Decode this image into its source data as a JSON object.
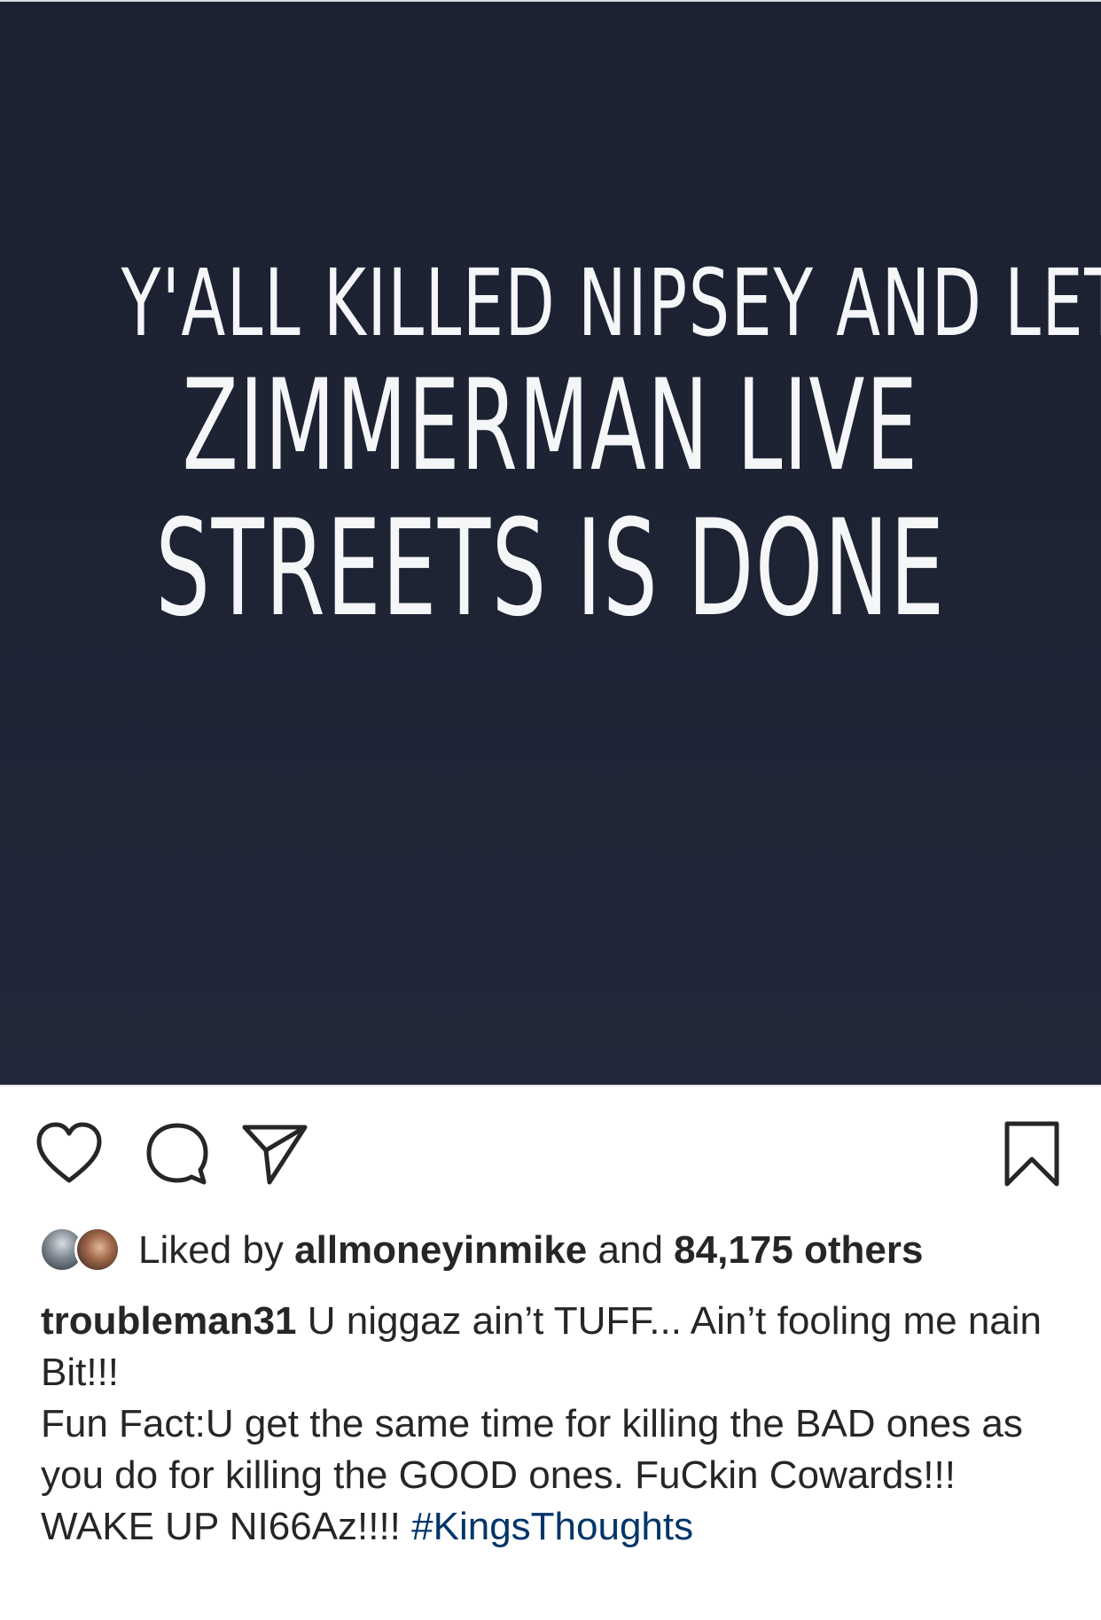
{
  "post": {
    "image_lines": [
      "Y'ALL KILLED NIPSEY AND LET",
      "ZIMMERMAN LIVE",
      "STREETS IS DONE"
    ],
    "image_background": "#1c2232"
  },
  "actions": {
    "like_icon": "heart-icon",
    "comment_icon": "comment-bubble-icon",
    "share_icon": "paper-plane-icon",
    "save_icon": "bookmark-icon"
  },
  "likes": {
    "prefix": "Liked by",
    "liker": "allmoneyinmike",
    "connector": "and",
    "others": "84,175 others"
  },
  "caption": {
    "username": "troubleman31",
    "line1": "U niggaz ain’t TUFF... Ain’t fooling me nain Bit!!!",
    "line2": "Fun Fact:U get the same time for killing the BAD ones as you do for killing the GOOD ones. FuCkin Cowards!!!",
    "line3_text": "WAKE UP NI66Az!!!!",
    "hashtag": "#KingsThoughts"
  },
  "colors": {
    "text": "#262626",
    "hashtag": "#003569"
  }
}
